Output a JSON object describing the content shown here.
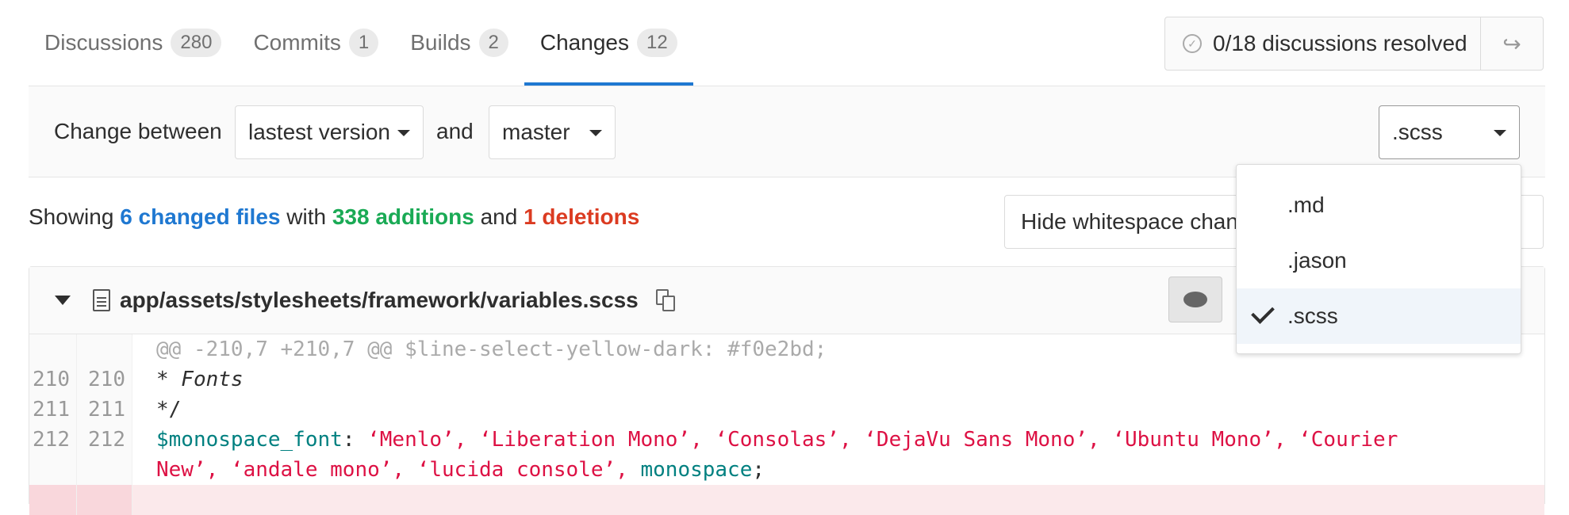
{
  "tabs": [
    {
      "label": "Discussions",
      "count": "280"
    },
    {
      "label": "Commits",
      "count": "1"
    },
    {
      "label": "Builds",
      "count": "2"
    },
    {
      "label": "Changes",
      "count": "12"
    }
  ],
  "resolve": {
    "text": "0/18 discussions resolved"
  },
  "toolbar": {
    "change_between": "Change between",
    "version_selected": "lastest version",
    "and": "and",
    "target_selected": "master",
    "filter_selected": ".scss"
  },
  "summary": {
    "showing": "Showing",
    "changed_files": "6 changed files",
    "with": "with",
    "additions": "338 additions",
    "and": "and",
    "deletions": "1 deletions"
  },
  "whitespace_button": "Hide whitespace changes",
  "file": {
    "path": "app/assets/stylesheets/framework/variables.scss"
  },
  "diff": {
    "hunk": "@@ -210,7 +210,7 @@ $line-select-yellow-dark: #f0e2bd;",
    "lines": [
      {
        "old": "210",
        "new": "210",
        "text": "* Fonts"
      },
      {
        "old": "211",
        "new": "211",
        "text": "*/"
      },
      {
        "old": "212",
        "new": "212",
        "var": "$monospace_font",
        "rest": ": ",
        "strings1": "‘Menlo’, ‘Liberation Mono’, ‘Consolas’, ‘DejaVu Sans Mono’, ‘Ubuntu Mono’, ‘Courier",
        "cont": "New’, ‘andale mono’, ‘lucida console’, ",
        "mono": "monospace",
        "end": ";"
      }
    ]
  },
  "filter_menu": {
    "options": [
      ".md",
      ".jason",
      ".scss"
    ],
    "selected": ".scss"
  },
  "colors": {
    "accent": "#1f78d1",
    "additions": "#1aaa55",
    "deletions": "#db3b21"
  }
}
